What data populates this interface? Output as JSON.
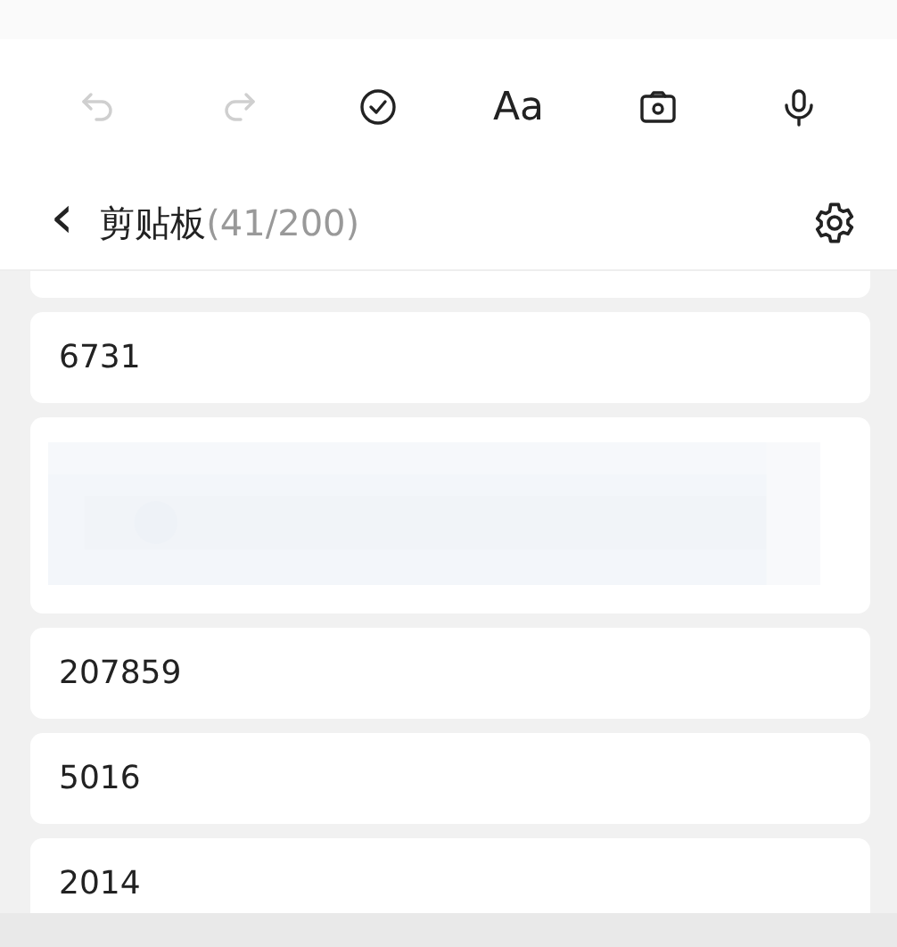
{
  "toolbar": [
    {
      "kind": "undo",
      "disabled": true
    },
    {
      "kind": "redo",
      "disabled": true
    },
    {
      "kind": "check",
      "disabled": false
    },
    {
      "kind": "text",
      "label": "Aa",
      "disabled": false
    },
    {
      "kind": "camera",
      "disabled": false
    },
    {
      "kind": "mic",
      "disabled": false
    }
  ],
  "header": {
    "back": "‹",
    "title": "剪贴板",
    "count": "(41/200)"
  },
  "clips": [
    {
      "kind": "partial"
    },
    {
      "kind": "text",
      "text": "6731"
    },
    {
      "kind": "picture"
    },
    {
      "kind": "text",
      "text": "207859"
    },
    {
      "kind": "text",
      "text": "5016"
    },
    {
      "kind": "text",
      "text": "2014"
    }
  ]
}
